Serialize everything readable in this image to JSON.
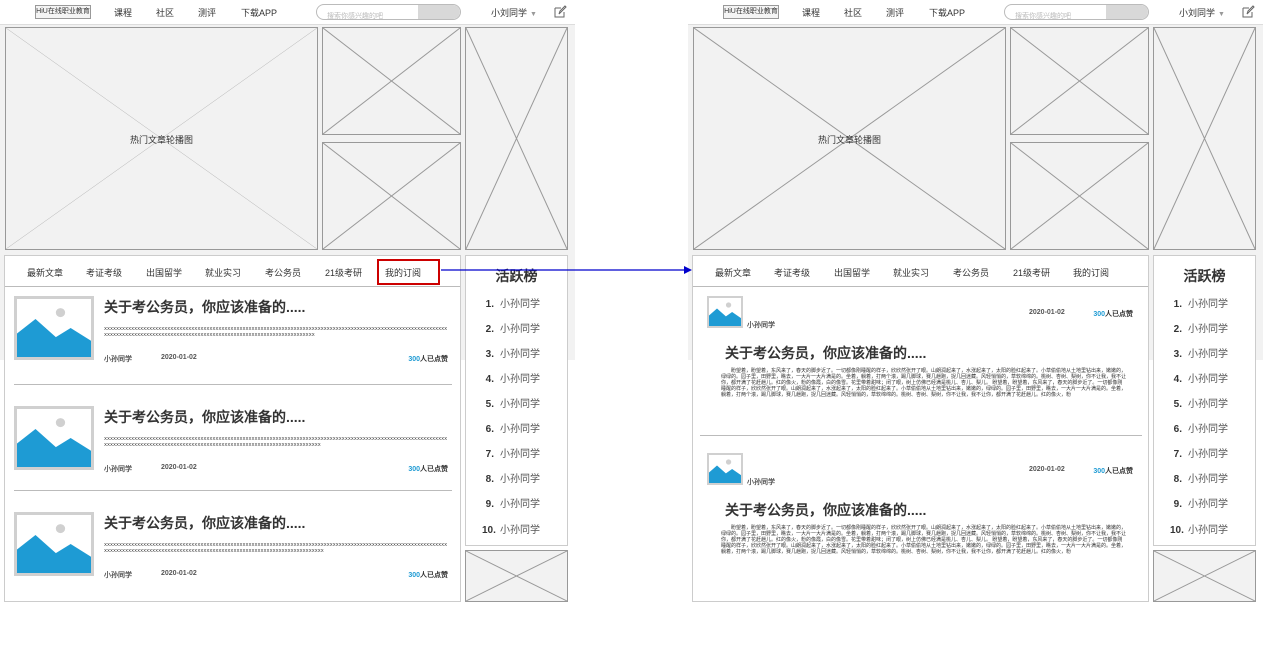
{
  "header": {
    "logo": "HiU在线职业教育",
    "nav": [
      "课程",
      "社区",
      "测评",
      "下载APP"
    ],
    "search_placeholder": "搜索你感兴趣的吧",
    "user_name": "小刘同学",
    "user_caret": "▼"
  },
  "banner": {
    "label": "热门文章轮播图"
  },
  "tabs": [
    "最新文章",
    "考证考级",
    "出国留学",
    "就业实习",
    "考公务员",
    "21级考研",
    "我的订阅"
  ],
  "selected_tab": "我的订阅",
  "highlight_color": "#c00000",
  "connector_color": "#0000cc",
  "accent_color": "#1e9bd4",
  "left_articles": [
    {
      "title": "关于考公务员，你应该准备的.....",
      "body": "xxxxxxxxxxxxxxxxxxxxxxxxxxxxxxxxxxxxxxxxxxxxxxxxxxxxxxxxxxxxxxxxxxxxxxxxxxxxxxxxxxxxxxxxxxxxxxxxxxxxxxxxxxxxxxxxxxxxxxxxxxxxxxxxxxxxxxxxxxxxxxxxxxxxxxxxxxxxxxxxxxxxxxxxxxxxxxxxxxxxxxxx",
      "author": "小孙同学",
      "date": "2020-01-02",
      "likes_num": "300",
      "likes_suffix": "人已点赞"
    },
    {
      "title": "关于考公务员，你应该准备的.....",
      "body": "xxxxxxxxxxxxxxxxxxxxxxxxxxxxxxxxxxxxxxxxxxxxxxxxxxxxxxxxxxxxxxxxxxxxxxxxxxxxxxxxxxxxxxxxxxxxxxxxxxxxxxxxxxxxxxxxxxxxxxxxxxxxxxxxxxxxxxxxxxxxxxxxxxxxxxxxxxxxxxxxxxxxxxxxxxxxxxxxxxxxxxxxxx",
      "author": "小孙同学",
      "date": "2020-01-02",
      "likes_num": "300",
      "likes_suffix": "人已点赞"
    },
    {
      "title": "关于考公务员，你应该准备的.....",
      "body": "xxxxxxxxxxxxxxxxxxxxxxxxxxxxxxxxxxxxxxxxxxxxxxxxxxxxxxxxxxxxxxxxxxxxxxxxxxxxxxxxxxxxxxxxxxxxxxxxxxxxxxxxxxxxxxxxxxxxxxxxxxxxxxxxxxxxxxxxxxxxxxxxxxxxxxxxxxxxxxxxxxxxxxxxxxxxxxxxxxxxxxxxxxx",
      "author": "小孙同学",
      "date": "2020-01-02",
      "likes_num": "300",
      "likes_suffix": "人已点赞"
    }
  ],
  "right_articles": [
    {
      "title": "关于考公务员，你应该准备的.....",
      "body": "盼望着，盼望着，东风来了，春天的脚步近了。一切都像刚睡醒的样子，欣欣然张开了眼。山朗润起来了，水涨起来了，太阳的脸红起来了。小草偷偷地从土地里钻出来，嫩嫩的，绿绿的。园子里，田野里，瞧去，一大片一大片满是的。坐着，躺着，打两个滚，踢几脚球，赛几趟跑，捉几回迷藏。风轻悄悄的，草软绵绵的。桃树、杏树、梨树，你不让我，我不让你，都开满了花赶趟儿。红的像火，粉的像霞，白的像雪。花里带着甜味；闭了眼，树上仿佛已经满是桃儿、杏儿、梨儿。 盼望着，盼望着，东风来了，春天的脚步近了。一切都像刚睡醒的样子，欣欣然张开了眼。山朗润起来了，水涨起来了，太阳的脸红起来了。小草偷偷地从土地里钻出来，嫩嫩的，绿绿的。园子里，田野里，瞧去，一大片一大片满是的。坐着，躺着，打两个滚，踢几脚球，赛几趟跑，捉几回迷藏。风轻悄悄的，草软绵绵的。桃树、杏树、梨树，你不让我，我不让你，都开满了花赶趟儿。红的像火，粉",
      "author": "小孙同学",
      "date": "2020-01-02",
      "likes_num": "300",
      "likes_suffix": "人已点赞"
    },
    {
      "title": "关于考公务员，你应该准备的.....",
      "body": "盼望着，盼望着，东风来了，春天的脚步近了。一切都像刚睡醒的样子，欣欣然张开了眼。山朗润起来了，水涨起来了，太阳的脸红起来了。小草偷偷地从土地里钻出来，嫩嫩的，绿绿的。园子里，田野里，瞧去，一大片一大片满是的。坐着，躺着，打两个滚，踢几脚球，赛几趟跑，捉几回迷藏。风轻悄悄的，草软绵绵的。桃树、杏树、梨树，你不让我，我不让你，都开满了花赶趟儿。红的像火，粉的像霞，白的像雪。花里带着甜味；闭了眼，树上仿佛已经满是桃儿、杏儿、梨儿。 盼望着，盼望着，东风来了，春天的脚步近了。一切都像刚睡醒的样子，欣欣然张开了眼。山朗润起来了，水涨起来了，太阳的脸红起来了。小草偷偷地从土地里钻出来，嫩嫩的，绿绿的。园子里，田野里，瞧去，一大片一大片满是的。坐着，躺着，打两个滚，踢几脚球，赛几趟跑，捉几回迷藏。风轻悄悄的，草软绵绵的。桃树、杏树、梨树，你不让我，我不让你，都开满了花赶趟儿。红的像火，粉",
      "author": "小孙同学",
      "date": "2020-01-02",
      "likes_num": "300",
      "likes_suffix": "人已点赞"
    }
  ],
  "sidebar": {
    "title": "活跃榜",
    "items": [
      {
        "rank": "1.",
        "name": "小孙同学"
      },
      {
        "rank": "2.",
        "name": "小孙同学"
      },
      {
        "rank": "3.",
        "name": "小孙同学"
      },
      {
        "rank": "4.",
        "name": "小孙同学"
      },
      {
        "rank": "5.",
        "name": "小孙同学"
      },
      {
        "rank": "6.",
        "name": "小孙同学"
      },
      {
        "rank": "7.",
        "name": "小孙同学"
      },
      {
        "rank": "8.",
        "name": "小孙同学"
      },
      {
        "rank": "9.",
        "name": "小孙同学"
      },
      {
        "rank": "10.",
        "name": "小孙同学"
      }
    ]
  },
  "icons": {
    "edit": "edit-icon",
    "image": "image-placeholder-icon"
  }
}
